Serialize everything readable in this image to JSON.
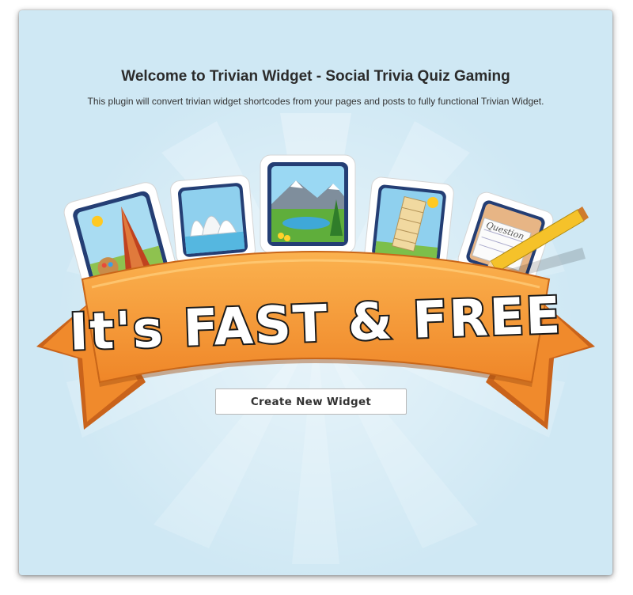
{
  "header": {
    "title": "Welcome to Trivian Widget - Social Trivia Quiz Gaming",
    "subtitle": "This plugin will convert trivian widget shortcodes from your pages and posts to fully functional Trivian Widget."
  },
  "banner": {
    "slogan": "It's FAST & FREE",
    "card_text": "Question",
    "cards": [
      "eiffel-tower-card-icon",
      "sydney-opera-house-card-icon",
      "mountain-lake-card-icon",
      "leaning-tower-pisa-card-icon",
      "question-paper-card-icon"
    ],
    "colors": {
      "ribbon": "#f59a3a",
      "ribbon_dark": "#c2601a",
      "background": "#cfe8f4"
    }
  },
  "actions": {
    "create_label": "Create New Widget"
  }
}
